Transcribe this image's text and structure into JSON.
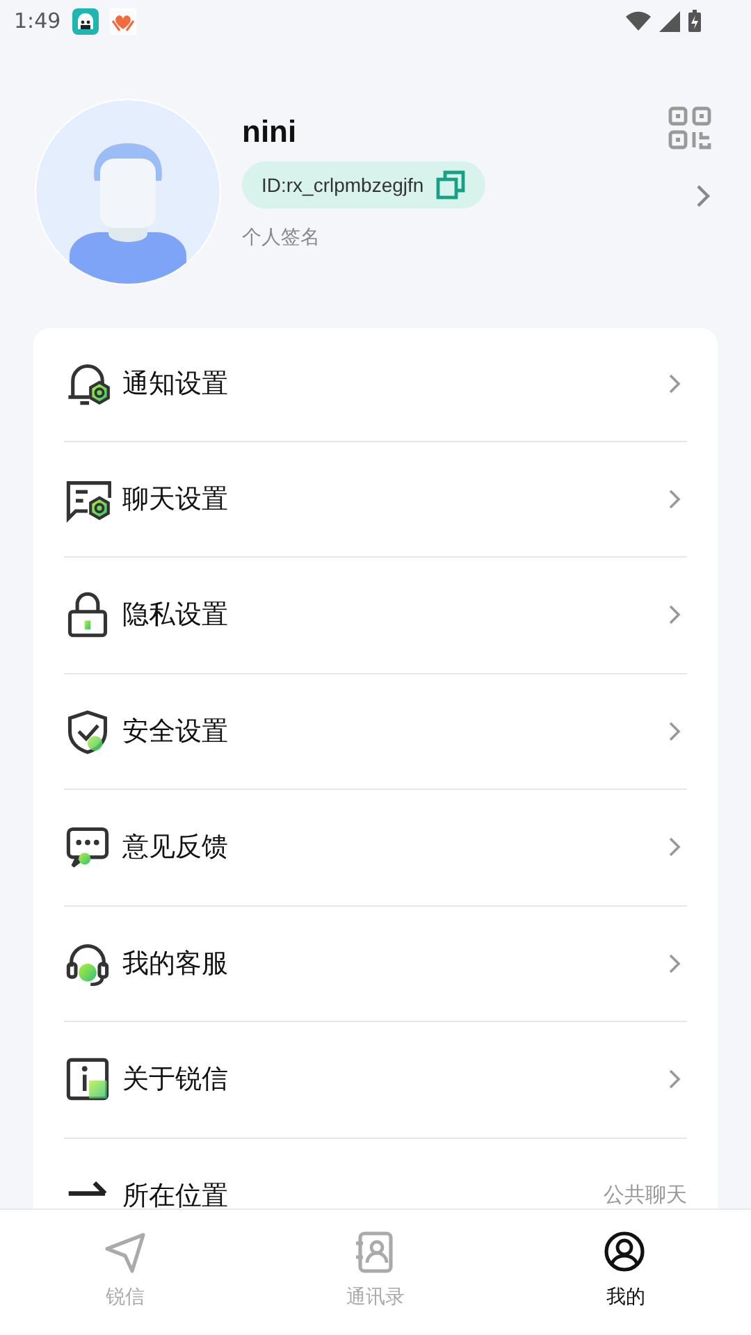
{
  "status_bar": {
    "time": "1:49"
  },
  "profile": {
    "name": "nini",
    "id": "ID:rx_crlpmbzegjfn",
    "signature": "个人签名"
  },
  "menu": [
    {
      "kind": "bell",
      "label": "通知设置"
    },
    {
      "kind": "chat",
      "label": "聊天设置"
    },
    {
      "kind": "lock",
      "label": "隐私设置"
    },
    {
      "kind": "shield",
      "label": "安全设置"
    },
    {
      "kind": "feedback",
      "label": "意见反馈"
    },
    {
      "kind": "headset",
      "label": "我的客服"
    },
    {
      "kind": "info",
      "label": "关于锐信"
    },
    {
      "kind": "location",
      "label": "所在位置",
      "value": "公共聊天"
    }
  ],
  "tabs": [
    {
      "kind": "send",
      "label": "锐信",
      "selected": false
    },
    {
      "kind": "contacts",
      "label": "通讯录",
      "selected": false
    },
    {
      "kind": "profile",
      "label": "我的",
      "selected": true
    }
  ]
}
